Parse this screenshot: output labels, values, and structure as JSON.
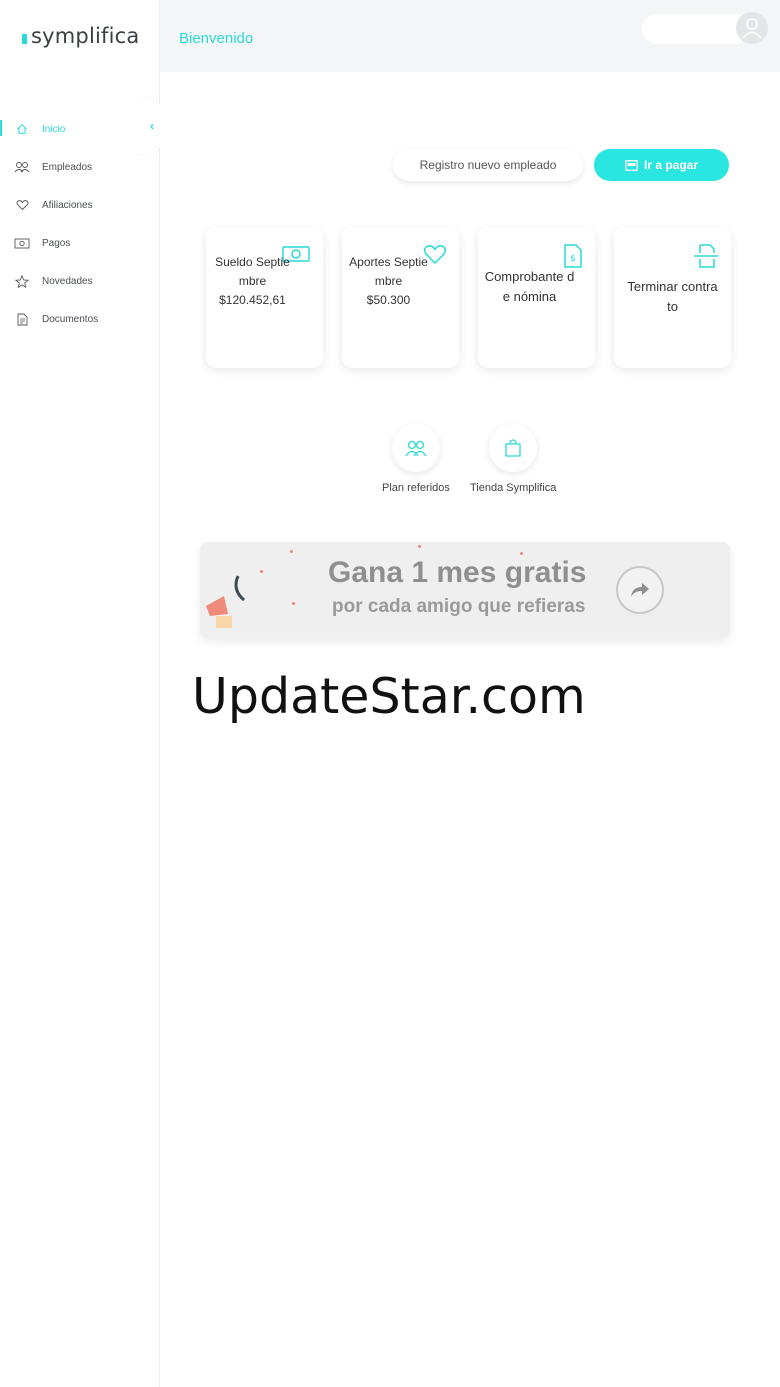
{
  "brand": {
    "logo_text": "symplifica",
    "accent": "#2ad9d9"
  },
  "header": {
    "welcome": "Bienvenido"
  },
  "sidebar": {
    "items": [
      {
        "label": "Inicio",
        "icon": "home-icon",
        "active": true
      },
      {
        "label": "Empleados",
        "icon": "users-icon"
      },
      {
        "label": "Afiliaciones",
        "icon": "heart-icon"
      },
      {
        "label": "Pagos",
        "icon": "money-icon"
      },
      {
        "label": "Novedades",
        "icon": "star-icon"
      },
      {
        "label": "Documentos",
        "icon": "document-icon"
      }
    ]
  },
  "actions": {
    "register_label": "Registro nuevo empleado",
    "pay_label": "Ir a pagar"
  },
  "cards": [
    {
      "title": "Sueldo Septiembre",
      "value": "$120.452,61",
      "icon": "money-icon"
    },
    {
      "title": "Aportes Septiembre",
      "value": "$50.300",
      "icon": "heart-icon"
    },
    {
      "title": "Comprobante de nómina",
      "icon": "payslip-icon"
    },
    {
      "title": "Terminar contrato",
      "icon": "contract-icon"
    }
  ],
  "quick_links": [
    {
      "label": "Plan referidos",
      "icon": "users-icon"
    },
    {
      "label": "Tienda Symplifica",
      "icon": "shopping-bag-icon"
    }
  ],
  "banner": {
    "title": "Gana 1 mes gratis",
    "subtitle": "por cada amigo que refieras"
  },
  "watermark": "UpdateStar.com"
}
